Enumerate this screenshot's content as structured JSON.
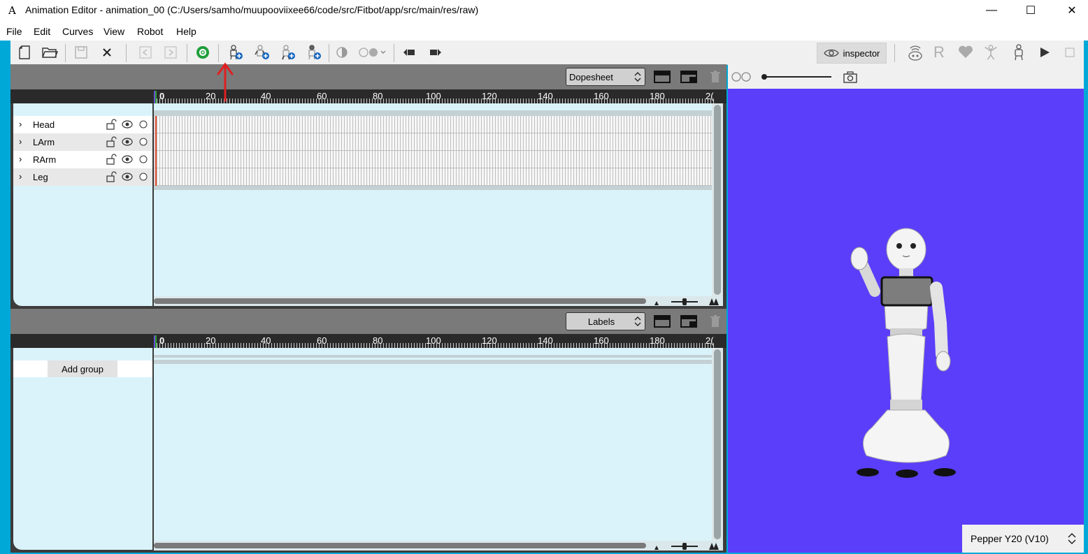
{
  "window": {
    "title": "Animation Editor - animation_00 (C:/Users/samho/muupooviixee66/code/src/Fitbot/app/src/main/res/raw)",
    "app_icon": "A",
    "minimize": "—",
    "maximize": "☐",
    "close": "✕"
  },
  "menu": [
    "File",
    "Edit",
    "Curves",
    "View",
    "Robot",
    "Help"
  ],
  "toolbar": {
    "inspector_label": "inspector",
    "robot_r_label": "R"
  },
  "dopesheet": {
    "mode": "Dopesheet",
    "ruler_ticks": [
      "0",
      "20",
      "40",
      "60",
      "80",
      "100",
      "120",
      "140",
      "160",
      "180",
      "2("
    ],
    "tracks": [
      {
        "name": "Head"
      },
      {
        "name": "LArm"
      },
      {
        "name": "RArm"
      },
      {
        "name": "Leg"
      }
    ]
  },
  "labels": {
    "mode": "Labels",
    "ruler_ticks": [
      "0",
      "20",
      "40",
      "60",
      "80",
      "100",
      "120",
      "140",
      "160",
      "180",
      "2("
    ],
    "add_group_label": "Add group"
  },
  "viewer": {
    "robot_model": "Pepper Y20 (V10)",
    "background_color": "#5b3ef9"
  }
}
